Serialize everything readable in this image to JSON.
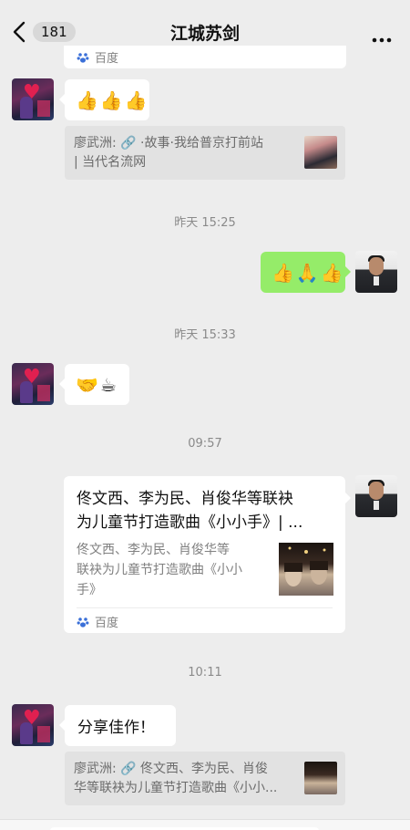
{
  "header": {
    "unread_count": "181",
    "title": "江城苏剑"
  },
  "top_card": {
    "source": "百度"
  },
  "messages": [
    {
      "sender": "left",
      "text": "👍👍👍"
    },
    {
      "quote": "廖武洲: 🔗 ·故事·我给普京打前站",
      "quote_line2": "| 当代名流网"
    },
    {
      "time": "昨天 15:25"
    },
    {
      "sender": "right",
      "text": "👍🙏👍"
    },
    {
      "time": "昨天 15:33"
    },
    {
      "sender": "left",
      "text": "🤝☕"
    },
    {
      "time": "09:57"
    },
    {
      "sender": "right",
      "card": {
        "title_line1": "佟文西、李为民、肖俊华等联袂",
        "title_line2": "为儿童节打造歌曲《小小手》| ...",
        "desc_line1": "佟文西、李为民、肖俊华等",
        "desc_line2": "联袂为儿童节打造歌曲《小小",
        "desc_line3": "手》",
        "source": "百度"
      }
    },
    {
      "time": "10:11"
    },
    {
      "sender": "left",
      "text": "分享佳作！"
    },
    {
      "quote": "廖武洲: 🔗 佟文西、李为民、肖俊",
      "quote_line2": "华等联袂为儿童节打造歌曲《小小..."
    }
  ],
  "colors": {
    "accent_green": "#95ec69",
    "background": "#ededed"
  }
}
